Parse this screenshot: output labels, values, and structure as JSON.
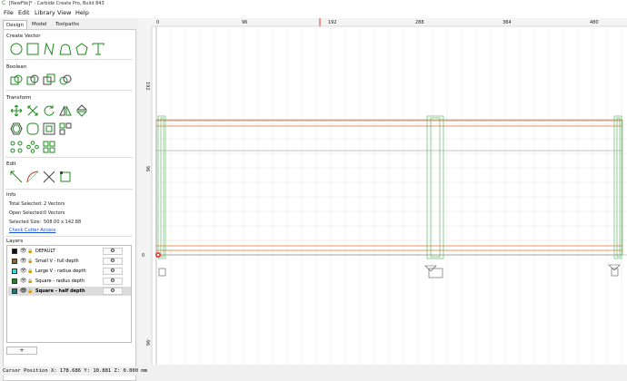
{
  "window": {
    "title": "[NewFile]* - Carbide Create Pro, Build 843"
  },
  "menu": {
    "file": "File",
    "edit": "Edit",
    "library": "Library",
    "view": "View",
    "help": "Help"
  },
  "tabs": {
    "design": "Design",
    "model": "Model",
    "toolpaths": "Toolpaths"
  },
  "sections": {
    "create_vector": "Create Vector",
    "boolean": "Boolean",
    "transform": "Transform",
    "edit": "Edit",
    "info": "Info",
    "layers": "Layers"
  },
  "info": {
    "total_selected_label": "Total Selected:",
    "total_selected_value": "2 Vectors",
    "open_selected_label": "Open Selected:",
    "open_selected_value": "0 Vectors",
    "selected_size_label": "Selected Size:",
    "selected_size_value": "508.00 x 142.88",
    "check_link": "Check Cutter Access"
  },
  "layers": [
    {
      "name": "DEFAULT",
      "color": "#111111"
    },
    {
      "name": "Small V - full depth",
      "color": "#8a6d1c"
    },
    {
      "name": "Large V - radius depth",
      "color": "#2fe0e8"
    },
    {
      "name": "Square - radius depth",
      "color": "#1d8a1d"
    },
    {
      "name": "Square - half depth",
      "color": "#127e8a",
      "selected": true
    }
  ],
  "add_layer_label": "+",
  "ruler": {
    "x_ticks": [
      "0",
      "96",
      "192",
      "288",
      "384",
      "480"
    ],
    "y_ticks": [
      "192",
      "96",
      "0",
      "-96"
    ]
  },
  "status": {
    "cursor": "Cursor Position X: 178.686 Y: 10.881 Z: 0.000 mm"
  }
}
